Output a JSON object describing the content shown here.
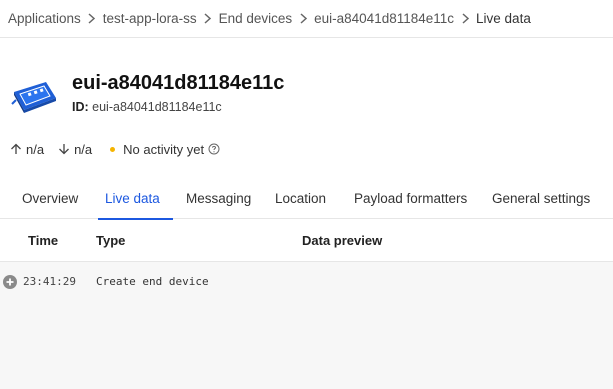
{
  "breadcrumb": {
    "items": [
      "Applications",
      "test-app-lora-ss",
      "End devices",
      "eui-a84041d81184e11c",
      "Live data"
    ]
  },
  "device": {
    "title": "eui-a84041d81184e11c",
    "id_label": "ID:",
    "id_value": "eui-a84041d81184e11c",
    "icon": "device-icon"
  },
  "stats": {
    "uplink": "n/a",
    "downlink": "n/a",
    "activity": "No activity yet",
    "activity_color": "#f5b400"
  },
  "tabs": [
    {
      "label": "Overview",
      "active": false
    },
    {
      "label": "Live data",
      "active": true
    },
    {
      "label": "Messaging",
      "active": false
    },
    {
      "label": "Location",
      "active": false
    },
    {
      "label": "Payload formatters",
      "active": false
    },
    {
      "label": "General settings",
      "active": false
    }
  ],
  "table": {
    "columns": [
      "Time",
      "Type",
      "Data preview"
    ],
    "rows": [
      {
        "icon": "plus-circle-icon",
        "time": "23:41:29",
        "type": "Create end device",
        "preview": ""
      }
    ]
  },
  "colors": {
    "accent": "#1c58e0"
  }
}
